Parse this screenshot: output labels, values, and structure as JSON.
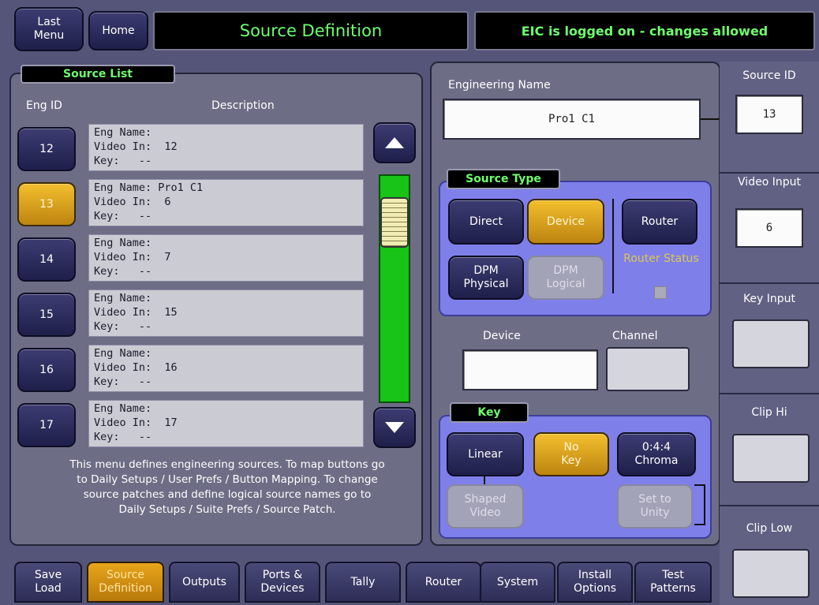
{
  "header": {
    "last_menu": "Last Menu",
    "home": "Home",
    "title": "Source Definition",
    "status": "EIC is logged on - changes allowed"
  },
  "source_list": {
    "title": "Source List",
    "col_eng_id": "Eng ID",
    "col_description": "Description",
    "rows": [
      {
        "id": "12",
        "name": "Eng Name:",
        "video": "Video In:  12",
        "key": "Key:   --"
      },
      {
        "id": "13",
        "name": "Eng Name: Pro1 C1",
        "video": "Video In:  6",
        "key": "Key:   --"
      },
      {
        "id": "14",
        "name": "Eng Name:",
        "video": "Video In:  7",
        "key": "Key:   --"
      },
      {
        "id": "15",
        "name": "Eng Name:",
        "video": "Video In:  15",
        "key": "Key:   --"
      },
      {
        "id": "16",
        "name": "Eng Name:",
        "video": "Video In:  16",
        "key": "Key:   --"
      },
      {
        "id": "17",
        "name": "Eng Name:",
        "video": "Video In:  17",
        "key": "Key:   --"
      }
    ],
    "selected_id": "13",
    "info": "This menu defines engineering sources. To map buttons go to Daily Setups / User Prefs / Button Mapping. To change source patches and define logical source names go to Daily Setups / Suite Prefs / Source Patch."
  },
  "engineering": {
    "label": "Engineering Name",
    "value": "Pro1 C1"
  },
  "source_type": {
    "title": "Source Type",
    "direct": "Direct",
    "device": "Device",
    "router": "Router",
    "dpm_physical": "DPM Physical",
    "dpm_logical": "DPM Logical",
    "router_status": "Router Status",
    "selected": "Device"
  },
  "device_channel": {
    "device_label": "Device",
    "channel_label": "Channel",
    "device_value": "",
    "channel_value": ""
  },
  "key": {
    "title": "Key",
    "linear": "Linear",
    "no_key": "No Key",
    "chroma": "0:4:4 Chroma",
    "shaped_video": "Shaped Video",
    "set_to_unity": "Set to Unity",
    "selected": "No Key"
  },
  "side": {
    "source_id_label": "Source ID",
    "source_id_value": "13",
    "video_input_label": "Video Input",
    "video_input_value": "6",
    "key_input_label": "Key Input",
    "clip_hi_label": "Clip Hi",
    "clip_low_label": "Clip Low"
  },
  "tabs": [
    {
      "label": "Save Load",
      "active": false
    },
    {
      "label": "Source Definition",
      "active": true
    },
    {
      "label": "Outputs",
      "active": false
    },
    {
      "label": "Ports & Devices",
      "active": false
    },
    {
      "label": "Tally",
      "active": false
    },
    {
      "label": "Router",
      "active": false
    },
    {
      "label": "System",
      "active": false
    },
    {
      "label": "Install Options",
      "active": false
    },
    {
      "label": "Test Patterns",
      "active": false
    }
  ],
  "scrollbar": {
    "position_fraction": 0.1
  },
  "colors": {
    "background": "#55557a",
    "panel": "#6d6d86",
    "active_gold": "#e8a51b",
    "status_green": "#6fff6f",
    "scroll_green": "#17c417",
    "blue_panel": "#7f7fea"
  }
}
